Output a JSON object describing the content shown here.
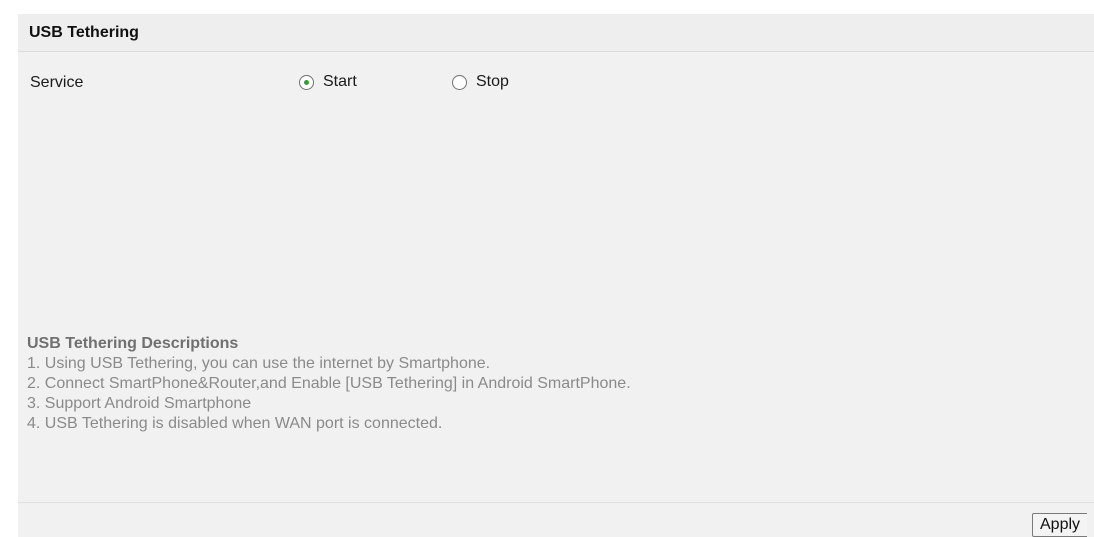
{
  "panel": {
    "title": "USB Tethering"
  },
  "service": {
    "label": "Service",
    "options": [
      {
        "label": "Start",
        "checked": true
      },
      {
        "label": "Stop",
        "checked": false
      }
    ]
  },
  "descriptions": {
    "title": "USB Tethering Descriptions",
    "items": [
      "1. Using USB Tethering, you can use the internet by Smartphone.",
      "2. Connect SmartPhone&Router,and Enable [USB Tethering] in Android SmartPhone.",
      "3. Support Android Smartphone",
      "4. USB Tethering is disabled when WAN port is connected."
    ]
  },
  "footer": {
    "apply_label": "Apply"
  },
  "colors": {
    "panel_bg": "#f1f1f1",
    "radio_checked": "#3c9a3c",
    "description_text": "#8a8a8a"
  }
}
